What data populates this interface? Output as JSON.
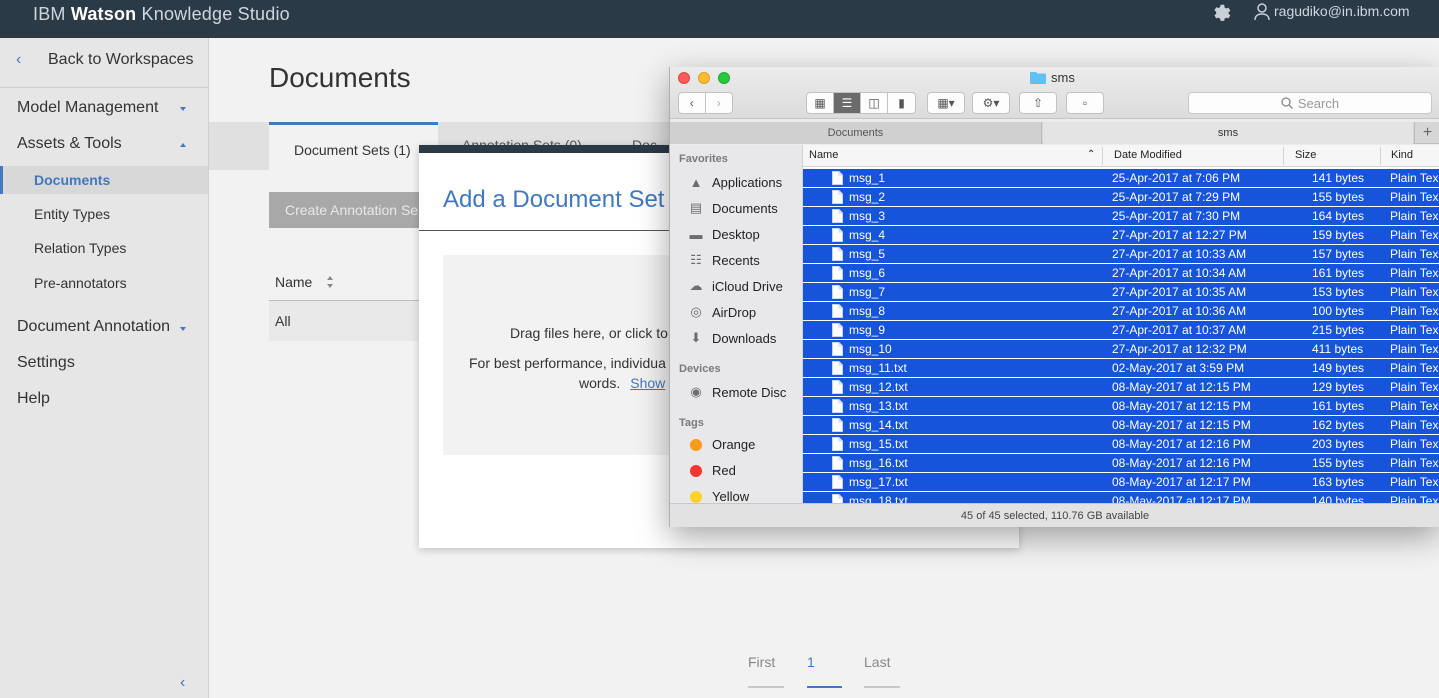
{
  "app": {
    "brand_light": "IBM",
    "brand_bold": "Watson",
    "brand_rest": "Knowledge Studio",
    "user_email": "ragudiko@in.ibm.com"
  },
  "sidebar": {
    "back_label": "Back to Workspaces",
    "sections": [
      {
        "label": "Model Management",
        "expanded": false
      },
      {
        "label": "Assets & Tools",
        "expanded": true
      },
      {
        "label": "Document Annotation",
        "expanded": false
      }
    ],
    "sub_items": [
      "Documents",
      "Entity Types",
      "Relation Types",
      "Pre-annotators"
    ],
    "active_item": "Documents",
    "bottom_items": [
      "Settings",
      "Help"
    ]
  },
  "main": {
    "title": "Documents",
    "tabs": [
      "Document Sets (1)",
      "Annotation Sets (0)",
      "Doc"
    ],
    "create_button": "Create Annotation Se",
    "table_header": "Name",
    "rows": [
      "All"
    ],
    "pagination": {
      "first": "First",
      "page": "1",
      "last": "Last"
    }
  },
  "modal": {
    "title": "Add a Document Set",
    "drop_text": "Drag files here, or click to",
    "hint_line1": "For best performance, individua",
    "hint_line2": "words.",
    "show_link": "Show"
  },
  "finder": {
    "window_title": "sms",
    "search_placeholder": "Search",
    "tabs": [
      "Documents",
      "sms"
    ],
    "sidebar": {
      "favorites_label": "Favorites",
      "favorites": [
        {
          "label": "Applications",
          "icon": "applications-icon"
        },
        {
          "label": "Documents",
          "icon": "documents-icon"
        },
        {
          "label": "Desktop",
          "icon": "desktop-icon"
        },
        {
          "label": "Recents",
          "icon": "recents-icon"
        },
        {
          "label": "iCloud Drive",
          "icon": "cloud-icon"
        },
        {
          "label": "AirDrop",
          "icon": "airdrop-icon"
        },
        {
          "label": "Downloads",
          "icon": "downloads-icon"
        }
      ],
      "devices_label": "Devices",
      "devices": [
        {
          "label": "Remote Disc",
          "icon": "disc-icon"
        }
      ],
      "tags_label": "Tags",
      "tags": [
        {
          "label": "Orange",
          "color": "#f89a1c"
        },
        {
          "label": "Red",
          "color": "#f5352f"
        },
        {
          "label": "Yellow",
          "color": "#fcd22a"
        }
      ]
    },
    "columns": {
      "name": "Name",
      "date": "Date Modified",
      "size": "Size",
      "kind": "Kind"
    },
    "files": [
      {
        "name": "msg_1",
        "date": "25-Apr-2017 at 7:06 PM",
        "size": "141 bytes",
        "kind": "Plain Tex"
      },
      {
        "name": "msg_2",
        "date": "25-Apr-2017 at 7:29 PM",
        "size": "155 bytes",
        "kind": "Plain Tex"
      },
      {
        "name": "msg_3",
        "date": "25-Apr-2017 at 7:30 PM",
        "size": "164 bytes",
        "kind": "Plain Tex"
      },
      {
        "name": "msg_4",
        "date": "27-Apr-2017 at 12:27 PM",
        "size": "159 bytes",
        "kind": "Plain Tex"
      },
      {
        "name": "msg_5",
        "date": "27-Apr-2017 at 10:33 AM",
        "size": "157 bytes",
        "kind": "Plain Tex"
      },
      {
        "name": "msg_6",
        "date": "27-Apr-2017 at 10:34 AM",
        "size": "161 bytes",
        "kind": "Plain Tex"
      },
      {
        "name": "msg_7",
        "date": "27-Apr-2017 at 10:35 AM",
        "size": "153 bytes",
        "kind": "Plain Tex"
      },
      {
        "name": "msg_8",
        "date": "27-Apr-2017 at 10:36 AM",
        "size": "100 bytes",
        "kind": "Plain Tex"
      },
      {
        "name": "msg_9",
        "date": "27-Apr-2017 at 10:37 AM",
        "size": "215 bytes",
        "kind": "Plain Tex"
      },
      {
        "name": "msg_10",
        "date": "27-Apr-2017 at 12:32 PM",
        "size": "411 bytes",
        "kind": "Plain Tex"
      },
      {
        "name": "msg_11.txt",
        "date": "02-May-2017 at 3:59 PM",
        "size": "149 bytes",
        "kind": "Plain Tex"
      },
      {
        "name": "msg_12.txt",
        "date": "08-May-2017 at 12:15 PM",
        "size": "129 bytes",
        "kind": "Plain Tex"
      },
      {
        "name": "msg_13.txt",
        "date": "08-May-2017 at 12:15 PM",
        "size": "161 bytes",
        "kind": "Plain Tex"
      },
      {
        "name": "msg_14.txt",
        "date": "08-May-2017 at 12:15 PM",
        "size": "162 bytes",
        "kind": "Plain Tex"
      },
      {
        "name": "msg_15.txt",
        "date": "08-May-2017 at 12:16 PM",
        "size": "203 bytes",
        "kind": "Plain Tex"
      },
      {
        "name": "msg_16.txt",
        "date": "08-May-2017 at 12:16 PM",
        "size": "155 bytes",
        "kind": "Plain Tex"
      },
      {
        "name": "msg_17.txt",
        "date": "08-May-2017 at 12:17 PM",
        "size": "163 bytes",
        "kind": "Plain Tex"
      },
      {
        "name": "msg_18.txt",
        "date": "08-May-2017 at 12:17 PM",
        "size": "140 bytes",
        "kind": "Plain Tex"
      }
    ],
    "status": "45 of 45 selected, 110.76 GB available"
  },
  "colors": {
    "topbar": "#2b3a47",
    "accent": "#4178be",
    "selection": "#1654d9"
  }
}
